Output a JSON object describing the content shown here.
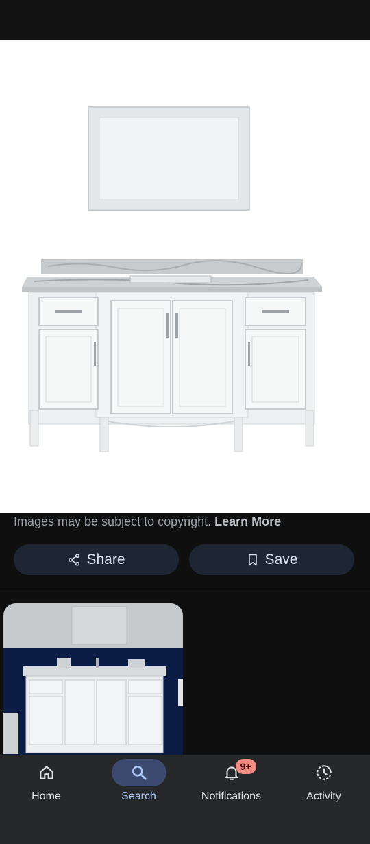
{
  "main_image": {
    "alt": "White bathroom vanity with marble top and matching mirror"
  },
  "copyright": {
    "text": "Images may be subject to copyright.",
    "learn_more": "Learn More"
  },
  "actions": {
    "share_label": "Share",
    "save_label": "Save"
  },
  "bottom_nav": {
    "items": [
      {
        "label": "Home",
        "icon": "home-icon",
        "active": false
      },
      {
        "label": "Search",
        "icon": "search-icon",
        "active": true
      },
      {
        "label": "Notifications",
        "icon": "bell-icon",
        "active": false,
        "badge": "9+"
      },
      {
        "label": "Activity",
        "icon": "activity-icon",
        "active": false
      }
    ]
  },
  "colors": {
    "accent": "#a8c7fa",
    "badge": "#f28b82",
    "background": "#0f0f10",
    "pill": "#1f2633"
  }
}
